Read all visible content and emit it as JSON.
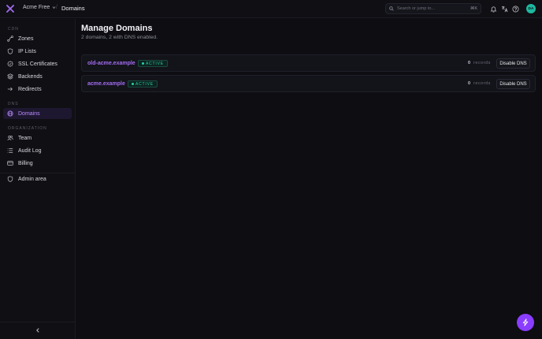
{
  "header": {
    "team_name": "Acme Free",
    "separator": "/",
    "page": "Domains",
    "search_placeholder": "Search or jump to...",
    "shortcut": "⌘K",
    "avatar_initials": "DA"
  },
  "sidebar": {
    "sections": [
      {
        "label": "CDN"
      },
      {
        "label": "DNS"
      },
      {
        "label": "ORGANIZATION"
      }
    ],
    "items": [
      {
        "label": "Zones",
        "icon": "zones-icon"
      },
      {
        "label": "IP Lists",
        "icon": "shield-icon"
      },
      {
        "label": "SSL Certificates",
        "icon": "certificate-icon"
      },
      {
        "label": "Backends",
        "icon": "server-icon"
      },
      {
        "label": "Redirects",
        "icon": "redirect-icon"
      },
      {
        "label": "Domains",
        "icon": "globe-icon",
        "active": true
      },
      {
        "label": "Team",
        "icon": "users-icon"
      },
      {
        "label": "Audit Log",
        "icon": "list-icon"
      },
      {
        "label": "Billing",
        "icon": "card-icon"
      },
      {
        "label": "Admin area",
        "icon": "shield-icon"
      }
    ]
  },
  "main": {
    "title": "Manage Domains",
    "subtitle": "2 domains, 2 with DNS enabled.",
    "domains": [
      {
        "name": "old-acme.example",
        "status": "ACTIVE",
        "record_count": "0",
        "records_label": "records",
        "action": "Disable DNS"
      },
      {
        "name": "acme.example",
        "status": "ACTIVE",
        "record_count": "0",
        "records_label": "records",
        "action": "Disable DNS"
      }
    ]
  },
  "colors": {
    "accent": "#8b3dff",
    "link": "#a36cf2",
    "status_active": "#2ad1a8",
    "background": "#0d0d12"
  }
}
